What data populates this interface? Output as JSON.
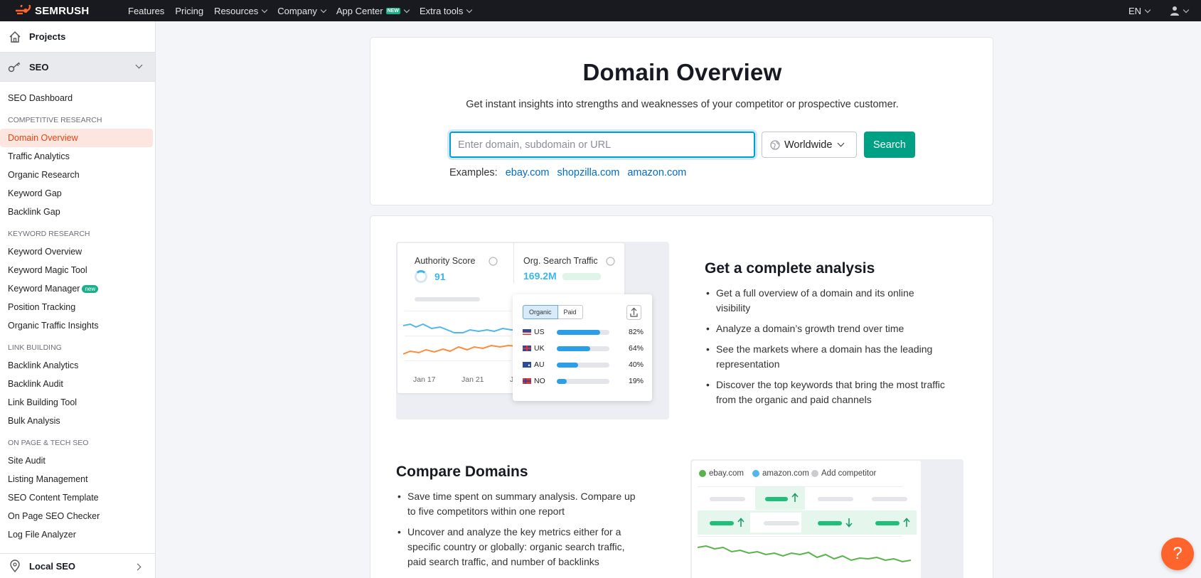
{
  "topbar": {
    "brand": "SEMRUSH",
    "nav": [
      {
        "label": "Features",
        "dropdown": false,
        "badge": ""
      },
      {
        "label": "Pricing",
        "dropdown": false,
        "badge": ""
      },
      {
        "label": "Resources",
        "dropdown": true,
        "badge": ""
      },
      {
        "label": "Company",
        "dropdown": true,
        "badge": ""
      },
      {
        "label": "App Center",
        "dropdown": true,
        "badge": "new"
      },
      {
        "label": "Extra tools",
        "dropdown": true,
        "badge": ""
      }
    ],
    "language": "EN"
  },
  "sidebar": {
    "projects": "Projects",
    "seo": "SEO",
    "dashboard": "SEO Dashboard",
    "sections": [
      {
        "heading": "COMPETITIVE RESEARCH",
        "items": [
          {
            "label": "Domain Overview",
            "active": true
          },
          {
            "label": "Traffic Analytics"
          },
          {
            "label": "Organic Research"
          },
          {
            "label": "Keyword Gap"
          },
          {
            "label": "Backlink Gap"
          }
        ]
      },
      {
        "heading": "KEYWORD RESEARCH",
        "items": [
          {
            "label": "Keyword Overview"
          },
          {
            "label": "Keyword Magic Tool"
          },
          {
            "label": "Keyword Manager",
            "badge": "new"
          },
          {
            "label": "Position Tracking"
          },
          {
            "label": "Organic Traffic Insights"
          }
        ]
      },
      {
        "heading": "LINK BUILDING",
        "items": [
          {
            "label": "Backlink Analytics"
          },
          {
            "label": "Backlink Audit"
          },
          {
            "label": "Link Building Tool"
          },
          {
            "label": "Bulk Analysis"
          }
        ]
      },
      {
        "heading": "ON PAGE & TECH SEO",
        "items": [
          {
            "label": "Site Audit"
          },
          {
            "label": "Listing Management"
          },
          {
            "label": "SEO Content Template"
          },
          {
            "label": "On Page SEO Checker"
          },
          {
            "label": "Log File Analyzer"
          }
        ]
      }
    ],
    "local": "Local SEO"
  },
  "hero": {
    "title": "Domain Overview",
    "subtitle": "Get instant insights into strengths and weaknesses of your competitor or prospective customer.",
    "search_placeholder": "Enter domain, subdomain or URL",
    "search_value": "",
    "database": "Worldwide",
    "search_button": "Search",
    "examples_label": "Examples:",
    "examples": [
      "ebay.com",
      "shopzilla.com",
      "amazon.com"
    ]
  },
  "feature1": {
    "illustration": {
      "authority_label": "Authority Score",
      "authority_value": "91",
      "traffic_label": "Org. Search Traffic",
      "traffic_value": "169.2M",
      "tab_organic": "Organic",
      "tab_paid": "Paid",
      "countries": [
        {
          "code": "US",
          "pct": "82%",
          "fill": 0.82
        },
        {
          "code": "UK",
          "pct": "64%",
          "fill": 0.64
        },
        {
          "code": "AU",
          "pct": "40%",
          "fill": 0.4
        },
        {
          "code": "NO",
          "pct": "19%",
          "fill": 0.19
        }
      ],
      "dates": [
        "Jan 17",
        "Jan 21",
        "J"
      ]
    },
    "title": "Get a complete analysis",
    "bullets": [
      "Get a full overview of a domain and its online visibility",
      "Analyze a domain’s growth trend over time",
      "See the markets where a domain has the leading representation",
      "Discover the top keywords that bring the most traffic from the organic and paid channels"
    ]
  },
  "feature2": {
    "title": "Compare Domains",
    "bullets": [
      "Save time spent on summary analysis. Compare up to five competitors within one report",
      "Uncover and analyze the key metrics either for a specific country or globally: organic search traffic, paid search traffic, and number of backlinks"
    ],
    "legend": [
      {
        "label": "ebay.com",
        "color": "#58b34a"
      },
      {
        "label": "amazon.com",
        "color": "#4fb7ee"
      },
      {
        "label": "Add competitor",
        "color": "#c9cbd1"
      }
    ]
  },
  "colors": {
    "accent": "#ff642d",
    "primary_button": "#00a084",
    "link": "#006dca",
    "active_nav": "#e8420f"
  },
  "help_icon": "?"
}
